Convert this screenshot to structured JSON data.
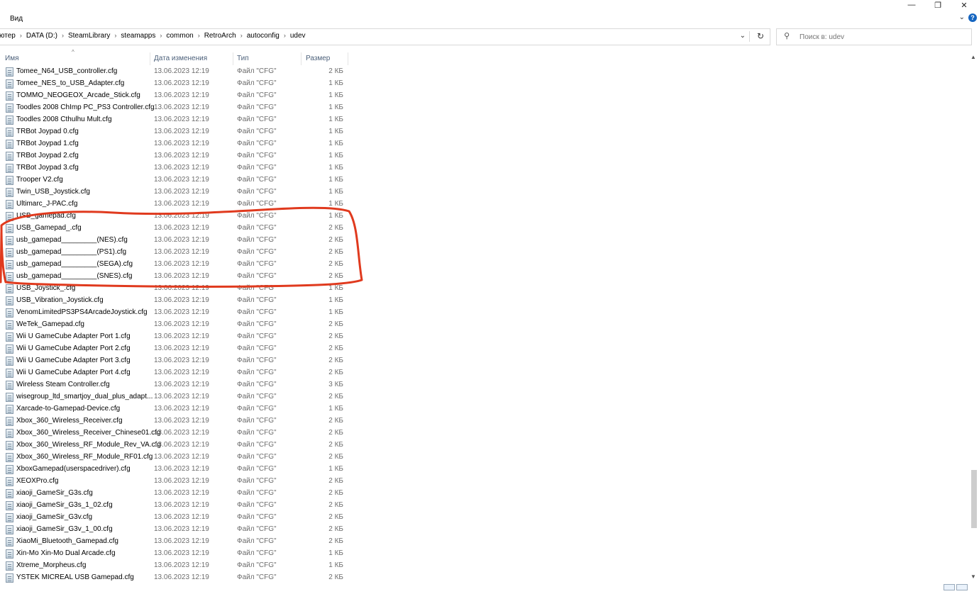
{
  "ribbon": {
    "menu_view": "Вид"
  },
  "window_buttons": {
    "minimize": "—",
    "restore": "❐",
    "close": "✕"
  },
  "help": {
    "label": "?",
    "chevron": "⌄"
  },
  "address": {
    "crumbs": [
      "ютер",
      "DATA (D:)",
      "SteamLibrary",
      "steamapps",
      "common",
      "RetroArch",
      "autoconfig",
      "udev"
    ],
    "separator": "›"
  },
  "search": {
    "placeholder": "Поиск в: udev"
  },
  "columns": {
    "name": "Имя",
    "date": "Дата изменения",
    "type": "Тип",
    "size": "Размер"
  },
  "files": [
    {
      "name": "Tomee_N64_USB_controller.cfg",
      "date": "13.06.2023 12:19",
      "type": "Файл \"CFG\"",
      "size": "2 КБ"
    },
    {
      "name": "Tomee_NES_to_USB_Adapter.cfg",
      "date": "13.06.2023 12:19",
      "type": "Файл \"CFG\"",
      "size": "1 КБ"
    },
    {
      "name": "TOMMO_NEOGEOX_Arcade_Stick.cfg",
      "date": "13.06.2023 12:19",
      "type": "Файл \"CFG\"",
      "size": "1 КБ"
    },
    {
      "name": "Toodles 2008 ChImp PC_PS3 Controller.cfg",
      "date": "13.06.2023 12:19",
      "type": "Файл \"CFG\"",
      "size": "1 КБ"
    },
    {
      "name": "Toodles 2008 Cthulhu Mult.cfg",
      "date": "13.06.2023 12:19",
      "type": "Файл \"CFG\"",
      "size": "1 КБ"
    },
    {
      "name": "TRBot Joypad 0.cfg",
      "date": "13.06.2023 12:19",
      "type": "Файл \"CFG\"",
      "size": "1 КБ"
    },
    {
      "name": "TRBot Joypad 1.cfg",
      "date": "13.06.2023 12:19",
      "type": "Файл \"CFG\"",
      "size": "1 КБ"
    },
    {
      "name": "TRBot Joypad 2.cfg",
      "date": "13.06.2023 12:19",
      "type": "Файл \"CFG\"",
      "size": "1 КБ"
    },
    {
      "name": "TRBot Joypad 3.cfg",
      "date": "13.06.2023 12:19",
      "type": "Файл \"CFG\"",
      "size": "1 КБ"
    },
    {
      "name": "Trooper V2.cfg",
      "date": "13.06.2023 12:19",
      "type": "Файл \"CFG\"",
      "size": "1 КБ"
    },
    {
      "name": "Twin_USB_Joystick.cfg",
      "date": "13.06.2023 12:19",
      "type": "Файл \"CFG\"",
      "size": "1 КБ"
    },
    {
      "name": "Ultimarc_J-PAC.cfg",
      "date": "13.06.2023 12:19",
      "type": "Файл \"CFG\"",
      "size": "1 КБ"
    },
    {
      "name": "USB_gamepad.cfg",
      "date": "13.06.2023 12:19",
      "type": "Файл \"CFG\"",
      "size": "1 КБ"
    },
    {
      "name": "USB_Gamepad_.cfg",
      "date": "13.06.2023 12:19",
      "type": "Файл \"CFG\"",
      "size": "2 КБ"
    },
    {
      "name": "usb_gamepad_________(NES).cfg",
      "date": "13.06.2023 12:19",
      "type": "Файл \"CFG\"",
      "size": "2 КБ"
    },
    {
      "name": "usb_gamepad_________(PS1).cfg",
      "date": "13.06.2023 12:19",
      "type": "Файл \"CFG\"",
      "size": "2 КБ"
    },
    {
      "name": "usb_gamepad_________(SEGA).cfg",
      "date": "13.06.2023 12:19",
      "type": "Файл \"CFG\"",
      "size": "2 КБ"
    },
    {
      "name": "usb_gamepad_________(SNES).cfg",
      "date": "13.06.2023 12:19",
      "type": "Файл \"CFG\"",
      "size": "2 КБ"
    },
    {
      "name": "USB_Joystick_.cfg",
      "date": "13.06.2023 12:19",
      "type": "Файл \"CFG\"",
      "size": "1 КБ"
    },
    {
      "name": "USB_Vibration_Joystick.cfg",
      "date": "13.06.2023 12:19",
      "type": "Файл \"CFG\"",
      "size": "1 КБ"
    },
    {
      "name": "VenomLimitedPS3PS4ArcadeJoystick.cfg",
      "date": "13.06.2023 12:19",
      "type": "Файл \"CFG\"",
      "size": "1 КБ"
    },
    {
      "name": "WeTek_Gamepad.cfg",
      "date": "13.06.2023 12:19",
      "type": "Файл \"CFG\"",
      "size": "2 КБ"
    },
    {
      "name": "Wii U GameCube Adapter Port 1.cfg",
      "date": "13.06.2023 12:19",
      "type": "Файл \"CFG\"",
      "size": "2 КБ"
    },
    {
      "name": "Wii U GameCube Adapter Port 2.cfg",
      "date": "13.06.2023 12:19",
      "type": "Файл \"CFG\"",
      "size": "2 КБ"
    },
    {
      "name": "Wii U GameCube Adapter Port 3.cfg",
      "date": "13.06.2023 12:19",
      "type": "Файл \"CFG\"",
      "size": "2 КБ"
    },
    {
      "name": "Wii U GameCube Adapter Port 4.cfg",
      "date": "13.06.2023 12:19",
      "type": "Файл \"CFG\"",
      "size": "2 КБ"
    },
    {
      "name": "Wireless Steam Controller.cfg",
      "date": "13.06.2023 12:19",
      "type": "Файл \"CFG\"",
      "size": "3 КБ"
    },
    {
      "name": "wisegroup_ltd_smartjoy_dual_plus_adapt...",
      "date": "13.06.2023 12:19",
      "type": "Файл \"CFG\"",
      "size": "2 КБ"
    },
    {
      "name": "Xarcade-to-Gamepad-Device.cfg",
      "date": "13.06.2023 12:19",
      "type": "Файл \"CFG\"",
      "size": "1 КБ"
    },
    {
      "name": "Xbox_360_Wireless_Receiver.cfg",
      "date": "13.06.2023 12:19",
      "type": "Файл \"CFG\"",
      "size": "2 КБ"
    },
    {
      "name": "Xbox_360_Wireless_Receiver_Chinese01.cfg",
      "date": "13.06.2023 12:19",
      "type": "Файл \"CFG\"",
      "size": "2 КБ"
    },
    {
      "name": "Xbox_360_Wireless_RF_Module_Rev_VA.cfg",
      "date": "13.06.2023 12:19",
      "type": "Файл \"CFG\"",
      "size": "2 КБ"
    },
    {
      "name": "Xbox_360_Wireless_RF_Module_RF01.cfg",
      "date": "13.06.2023 12:19",
      "type": "Файл \"CFG\"",
      "size": "2 КБ"
    },
    {
      "name": "XboxGamepad(userspacedriver).cfg",
      "date": "13.06.2023 12:19",
      "type": "Файл \"CFG\"",
      "size": "1 КБ"
    },
    {
      "name": "XEOXPro.cfg",
      "date": "13.06.2023 12:19",
      "type": "Файл \"CFG\"",
      "size": "2 КБ"
    },
    {
      "name": "xiaoji_GameSir_G3s.cfg",
      "date": "13.06.2023 12:19",
      "type": "Файл \"CFG\"",
      "size": "2 КБ"
    },
    {
      "name": "xiaoji_GameSir_G3s_1_02.cfg",
      "date": "13.06.2023 12:19",
      "type": "Файл \"CFG\"",
      "size": "2 КБ"
    },
    {
      "name": "xiaoji_GameSir_G3v.cfg",
      "date": "13.06.2023 12:19",
      "type": "Файл \"CFG\"",
      "size": "2 КБ"
    },
    {
      "name": "xiaoji_GameSir_G3v_1_00.cfg",
      "date": "13.06.2023 12:19",
      "type": "Файл \"CFG\"",
      "size": "2 КБ"
    },
    {
      "name": "XiaoMi_Bluetooth_Gamepad.cfg",
      "date": "13.06.2023 12:19",
      "type": "Файл \"CFG\"",
      "size": "2 КБ"
    },
    {
      "name": "Xin-Mo Xin-Mo Dual Arcade.cfg",
      "date": "13.06.2023 12:19",
      "type": "Файл \"CFG\"",
      "size": "1 КБ"
    },
    {
      "name": "Xtreme_Morpheus.cfg",
      "date": "13.06.2023 12:19",
      "type": "Файл \"CFG\"",
      "size": "1 КБ"
    },
    {
      "name": "YSTEK MICREAL USB Gamepad.cfg",
      "date": "13.06.2023 12:19",
      "type": "Файл \"CFG\"",
      "size": "2 КБ"
    }
  ],
  "annotation_color": "#e03a1e",
  "scroll": {
    "position_fraction": 0.89
  }
}
